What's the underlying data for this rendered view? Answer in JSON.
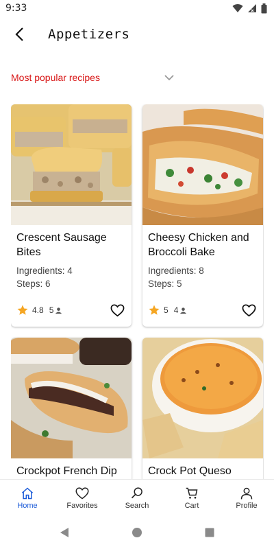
{
  "status_bar": {
    "time": "9:33",
    "icons": [
      "wifi-icon",
      "signal-icon",
      "battery-icon"
    ]
  },
  "app_bar": {
    "title": "Appetizers",
    "back_icon": "back-arrow-icon"
  },
  "filter": {
    "label": "Most popular recipes",
    "icon": "chevron-down-icon",
    "color": "#d81414"
  },
  "recipes": [
    {
      "name": "Crescent Sausage Bites",
      "ingredients": "Ingredients: 4",
      "steps": "Steps: 6",
      "rating": "4.8",
      "reviews": "5",
      "image_desc": "crescent-sausage-bites-photo"
    },
    {
      "name": "Cheesy Chicken and Broccoli Bake",
      "ingredients": "Ingredients: 8",
      "steps": "Steps: 5",
      "rating": "5",
      "reviews": "4",
      "image_desc": "cheesy-chicken-broccoli-bake-photo"
    },
    {
      "name": "Crockpot French Dip",
      "image_desc": "crockpot-french-dip-photo"
    },
    {
      "name": "Crock Pot Queso",
      "image_desc": "crock-pot-queso-photo"
    }
  ],
  "bottom_nav": [
    {
      "label": "Home",
      "icon": "home-icon",
      "active": true
    },
    {
      "label": "Favorites",
      "icon": "heart-icon",
      "active": false
    },
    {
      "label": "Search",
      "icon": "search-icon",
      "active": false
    },
    {
      "label": "Cart",
      "icon": "cart-icon",
      "active": false
    },
    {
      "label": "Profile",
      "icon": "profile-icon",
      "active": false
    }
  ],
  "colors": {
    "accent": "#1b5bd8",
    "star": "#f5a623",
    "filter_red": "#d81414"
  }
}
